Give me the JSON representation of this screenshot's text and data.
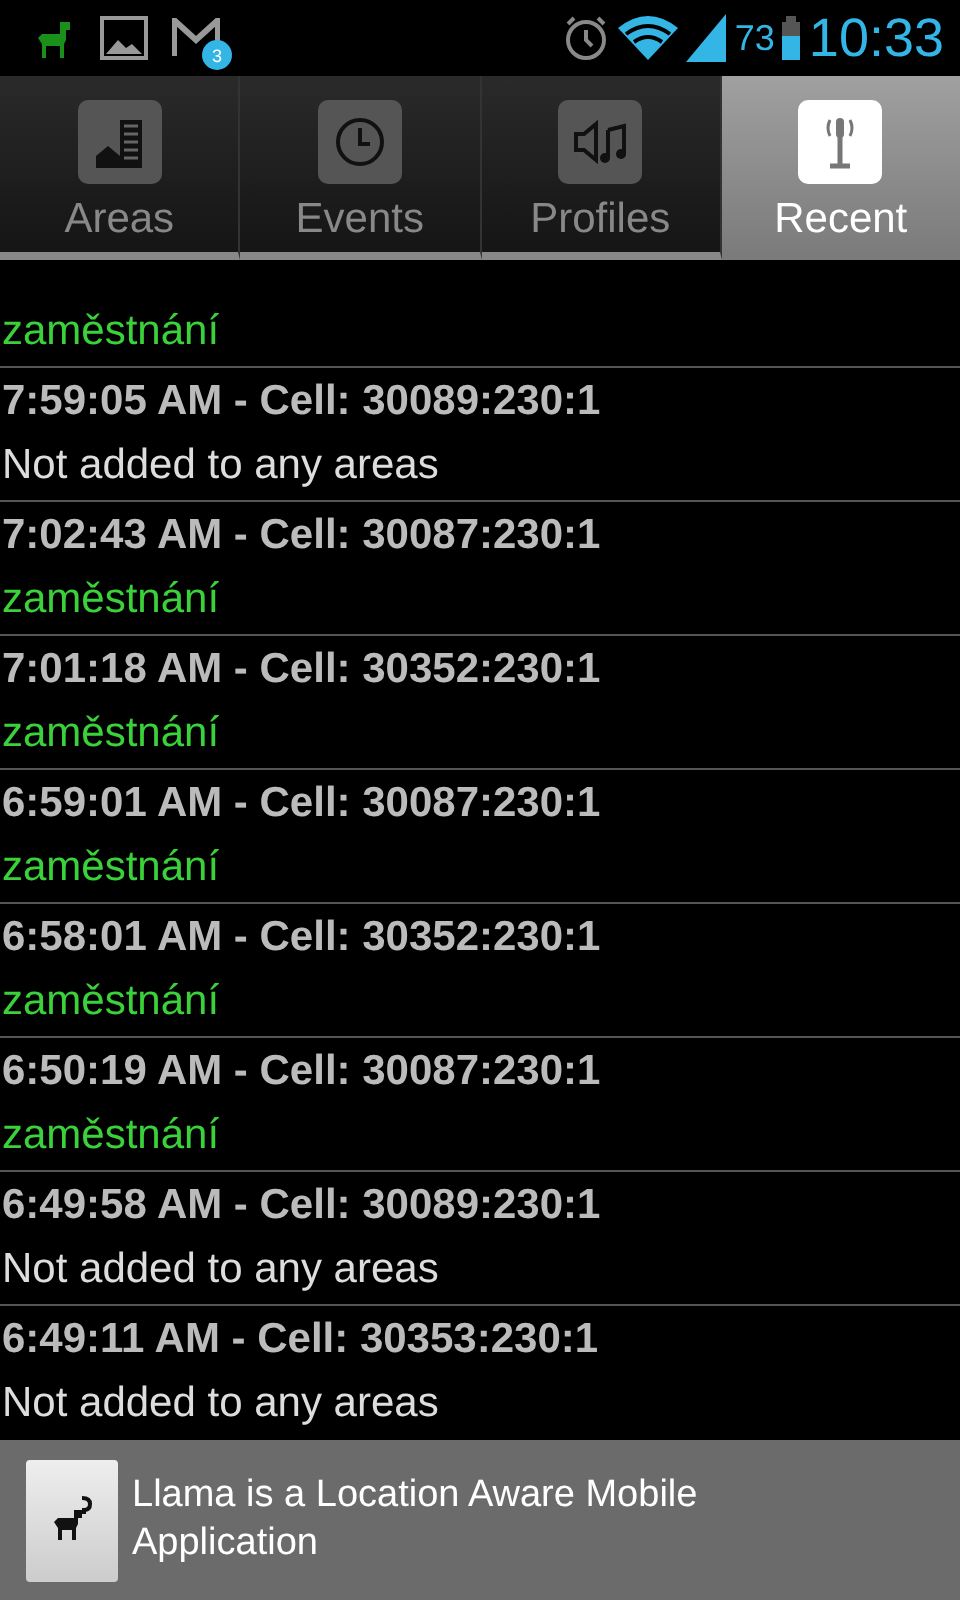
{
  "status_bar": {
    "notification_badge": "3",
    "battery": "73",
    "time": "10:33"
  },
  "tabs": [
    {
      "label": "Areas",
      "kind": "building",
      "selected": false
    },
    {
      "label": "Events",
      "kind": "clock",
      "selected": false
    },
    {
      "label": "Profiles",
      "kind": "sound",
      "selected": false
    },
    {
      "label": "Recent",
      "kind": "tower",
      "selected": true
    }
  ],
  "entries": [
    {
      "detail": "zaměstnání",
      "kind": "area"
    },
    {
      "title": "7:59:05 AM - Cell: 30089:230:1",
      "detail": "Not added to any areas",
      "kind": "none"
    },
    {
      "title": "7:02:43 AM - Cell: 30087:230:1",
      "detail": "zaměstnání",
      "kind": "area"
    },
    {
      "title": "7:01:18 AM - Cell: 30352:230:1",
      "detail": "zaměstnání",
      "kind": "area"
    },
    {
      "title": "6:59:01 AM - Cell: 30087:230:1",
      "detail": "zaměstnání",
      "kind": "area"
    },
    {
      "title": "6:58:01 AM - Cell: 30352:230:1",
      "detail": "zaměstnání",
      "kind": "area"
    },
    {
      "title": "6:50:19 AM - Cell: 30087:230:1",
      "detail": "zaměstnání",
      "kind": "area"
    },
    {
      "title": "6:49:58 AM - Cell: 30089:230:1",
      "detail": "Not added to any areas",
      "kind": "none"
    },
    {
      "title": "6:49:11 AM - Cell: 30353:230:1",
      "detail": "Not added to any areas",
      "kind": "none"
    }
  ],
  "banner": {
    "text": "Llama is a Location Aware Mobile Application"
  }
}
